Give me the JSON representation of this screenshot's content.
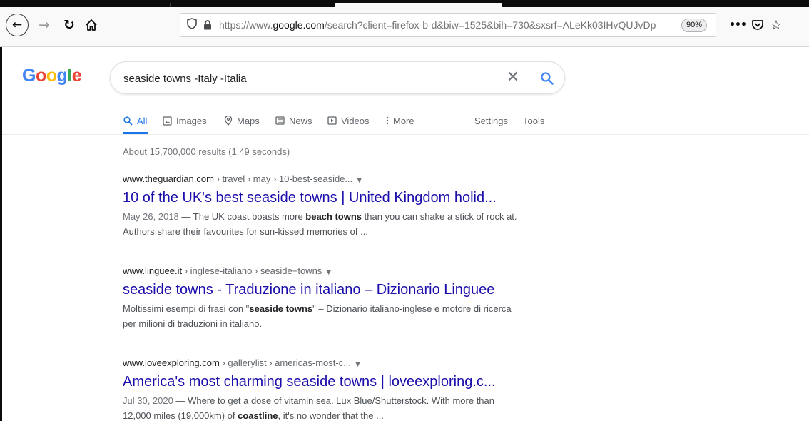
{
  "browser": {
    "url_prefix": "https://www.",
    "url_host": "google.com",
    "url_rest": "/search?client=firefox-b-d&biw=1525&bih=730&sxsrf=ALeKk03IHvQUJvDp",
    "zoom": "90%"
  },
  "search": {
    "query": "seaside towns -Italy -Italia",
    "clear_glyph": "✕"
  },
  "logo": {
    "letters": [
      "G",
      "o",
      "o",
      "g",
      "l",
      "e"
    ],
    "colors": [
      "#4285f4",
      "#ea4335",
      "#fbbc05",
      "#4285f4",
      "#34a853",
      "#ea4335"
    ]
  },
  "tabs": {
    "all": "All",
    "images": "Images",
    "maps": "Maps",
    "news": "News",
    "videos": "Videos",
    "more": "More",
    "settings": "Settings",
    "tools": "Tools"
  },
  "stats": "About 15,700,000 results (1.49 seconds)",
  "results": [
    {
      "domain": "www.theguardian.com",
      "crumbs": " › travel › may › 10-best-seaside...",
      "title": "10 of the UK's best seaside towns | United Kingdom holid...",
      "date": "May 26, 2018",
      "snippet_a": " — The UK coast boasts more ",
      "bold_a": "beach towns",
      "snippet_b": " than you can shake a stick of rock at. Authors share their favourites for sun-kissed memories of ..."
    },
    {
      "domain": "www.linguee.it",
      "crumbs": " › inglese-italiano › seaside+towns",
      "title": "seaside towns - Traduzione in italiano – Dizionario Linguee",
      "snippet_a": "Moltissimi esempi di frasi con \"",
      "bold_a": "seaside towns",
      "snippet_b": "\" – Dizionario italiano-inglese e motore di ricerca per milioni di traduzioni in italiano."
    },
    {
      "domain": "www.loveexploring.com",
      "crumbs": " › gallerylist › americas-most-c...",
      "title": "America's most charming seaside towns | loveexploring.c...",
      "date": "Jul 30, 2020",
      "snippet_a": " — Where to get a dose of vitamin sea. Lux Blue/Shutterstock. With more than 12,000 miles (19,000km) of ",
      "bold_a": "coastline",
      "snippet_b": ", it's no wonder that the ..."
    }
  ],
  "colors": {
    "link": "#1a0dab",
    "accent": "#1a73e8"
  },
  "icons": [
    "back-arrow-icon",
    "forward-arrow-icon",
    "reload-icon",
    "home-icon",
    "shield-icon",
    "lock-icon",
    "more-dots-icon",
    "pocket-icon",
    "star-icon",
    "search-icon",
    "clear-icon",
    "images-icon",
    "maps-pin-icon",
    "news-icon",
    "videos-icon",
    "more-vertical-icon",
    "dropdown-triangle-icon"
  ]
}
